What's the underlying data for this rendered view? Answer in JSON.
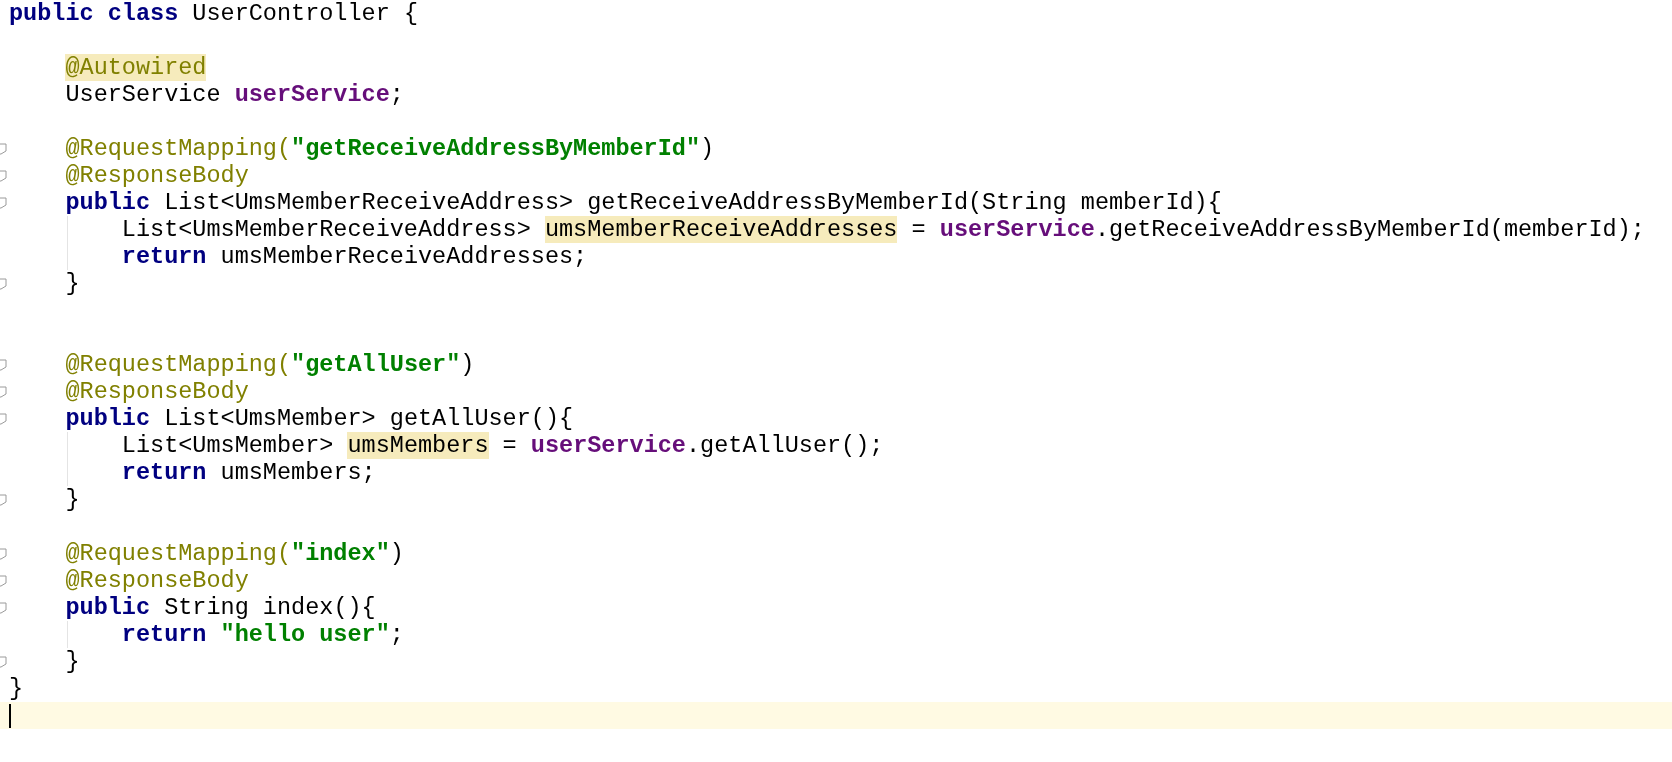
{
  "editor": {
    "lines": [
      {
        "fold": false,
        "current": false,
        "tokens": [
          {
            "text": "public class",
            "kind": "keyword"
          },
          {
            "text": " UserController {",
            "kind": "plain"
          }
        ]
      },
      {
        "fold": false,
        "current": false
      },
      {
        "fold": false,
        "current": false,
        "tokens": [
          {
            "text": "    @Autowired",
            "kind": "annotation",
            "highlighted": true
          }
        ]
      },
      {
        "fold": false,
        "current": false,
        "tokens": [
          {
            "text": "    UserService ",
            "kind": "plain"
          },
          {
            "text": "userService",
            "kind": "field"
          },
          {
            "text": ";",
            "kind": "plain"
          }
        ]
      },
      {
        "fold": false,
        "current": false
      },
      {
        "fold": true,
        "current": false,
        "tokens": [
          {
            "text": "    @RequestMapping(",
            "kind": "annotation"
          },
          {
            "text": "\"getReceiveAddressByMemberId\"",
            "kind": "string"
          },
          {
            "text": ")",
            "kind": "plain"
          }
        ]
      },
      {
        "fold": true,
        "current": false,
        "tokens": [
          {
            "text": "    @ResponseBody",
            "kind": "annotation"
          }
        ]
      },
      {
        "fold": true,
        "current": false,
        "tokens": [
          {
            "text": "    public",
            "kind": "keyword"
          },
          {
            "text": " List<UmsMemberReceiveAddress> getReceiveAddressByMemberId(String memberId){",
            "kind": "plain"
          }
        ]
      },
      {
        "fold": false,
        "current": false,
        "guide": true,
        "tokens": [
          {
            "text": "        List<UmsMemberReceiveAddress> ",
            "kind": "plain"
          },
          {
            "text": "umsMemberReceiveAddresses",
            "kind": "plain",
            "highlighted": true
          },
          {
            "text": " = ",
            "kind": "plain"
          },
          {
            "text": "userService",
            "kind": "field"
          },
          {
            "text": ".getReceiveAddressByMemberId(memberId);",
            "kind": "plain"
          }
        ]
      },
      {
        "fold": false,
        "current": false,
        "guide": true,
        "tokens": [
          {
            "text": "        return",
            "kind": "keyword"
          },
          {
            "text": " umsMemberReceiveAddresses;",
            "kind": "plain"
          }
        ]
      },
      {
        "fold": true,
        "current": false,
        "tokens": [
          {
            "text": "    }",
            "kind": "plain"
          }
        ]
      },
      {
        "fold": false,
        "current": false
      },
      {
        "fold": false,
        "current": false
      },
      {
        "fold": true,
        "current": false,
        "tokens": [
          {
            "text": "    @RequestMapping(",
            "kind": "annotation"
          },
          {
            "text": "\"getAllUser\"",
            "kind": "string"
          },
          {
            "text": ")",
            "kind": "plain"
          }
        ]
      },
      {
        "fold": true,
        "current": false,
        "tokens": [
          {
            "text": "    @ResponseBody",
            "kind": "annotation"
          }
        ]
      },
      {
        "fold": true,
        "current": false,
        "tokens": [
          {
            "text": "    public",
            "kind": "keyword"
          },
          {
            "text": " List<UmsMember> getAllUser(){",
            "kind": "plain"
          }
        ]
      },
      {
        "fold": false,
        "current": false,
        "guide": true,
        "tokens": [
          {
            "text": "        List<UmsMember> ",
            "kind": "plain"
          },
          {
            "text": "umsMembers",
            "kind": "plain",
            "highlighted": true
          },
          {
            "text": " = ",
            "kind": "plain"
          },
          {
            "text": "userService",
            "kind": "field"
          },
          {
            "text": ".getAllUser();",
            "kind": "plain"
          }
        ]
      },
      {
        "fold": false,
        "current": false,
        "guide": true,
        "tokens": [
          {
            "text": "        return",
            "kind": "keyword"
          },
          {
            "text": " umsMembers;",
            "kind": "plain"
          }
        ]
      },
      {
        "fold": true,
        "current": false,
        "tokens": [
          {
            "text": "    }",
            "kind": "plain"
          }
        ]
      },
      {
        "fold": false,
        "current": false
      },
      {
        "fold": true,
        "current": false,
        "tokens": [
          {
            "text": "    @RequestMapping(",
            "kind": "annotation"
          },
          {
            "text": "\"index\"",
            "kind": "string"
          },
          {
            "text": ")",
            "kind": "plain"
          }
        ]
      },
      {
        "fold": true,
        "current": false,
        "tokens": [
          {
            "text": "    @ResponseBody",
            "kind": "annotation"
          }
        ]
      },
      {
        "fold": true,
        "current": false,
        "tokens": [
          {
            "text": "    public",
            "kind": "keyword"
          },
          {
            "text": " String index(){",
            "kind": "plain"
          }
        ]
      },
      {
        "fold": false,
        "current": false,
        "guide": true,
        "tokens": [
          {
            "text": "        return ",
            "kind": "keyword"
          },
          {
            "text": "\"hello user\"",
            "kind": "string"
          },
          {
            "text": ";",
            "kind": "plain"
          }
        ]
      },
      {
        "fold": true,
        "current": false,
        "tokens": [
          {
            "text": "    }",
            "kind": "plain"
          }
        ]
      },
      {
        "fold": false,
        "current": false,
        "tokens": [
          {
            "text": "}",
            "kind": "plain"
          }
        ]
      },
      {
        "fold": false,
        "current": true
      }
    ]
  }
}
